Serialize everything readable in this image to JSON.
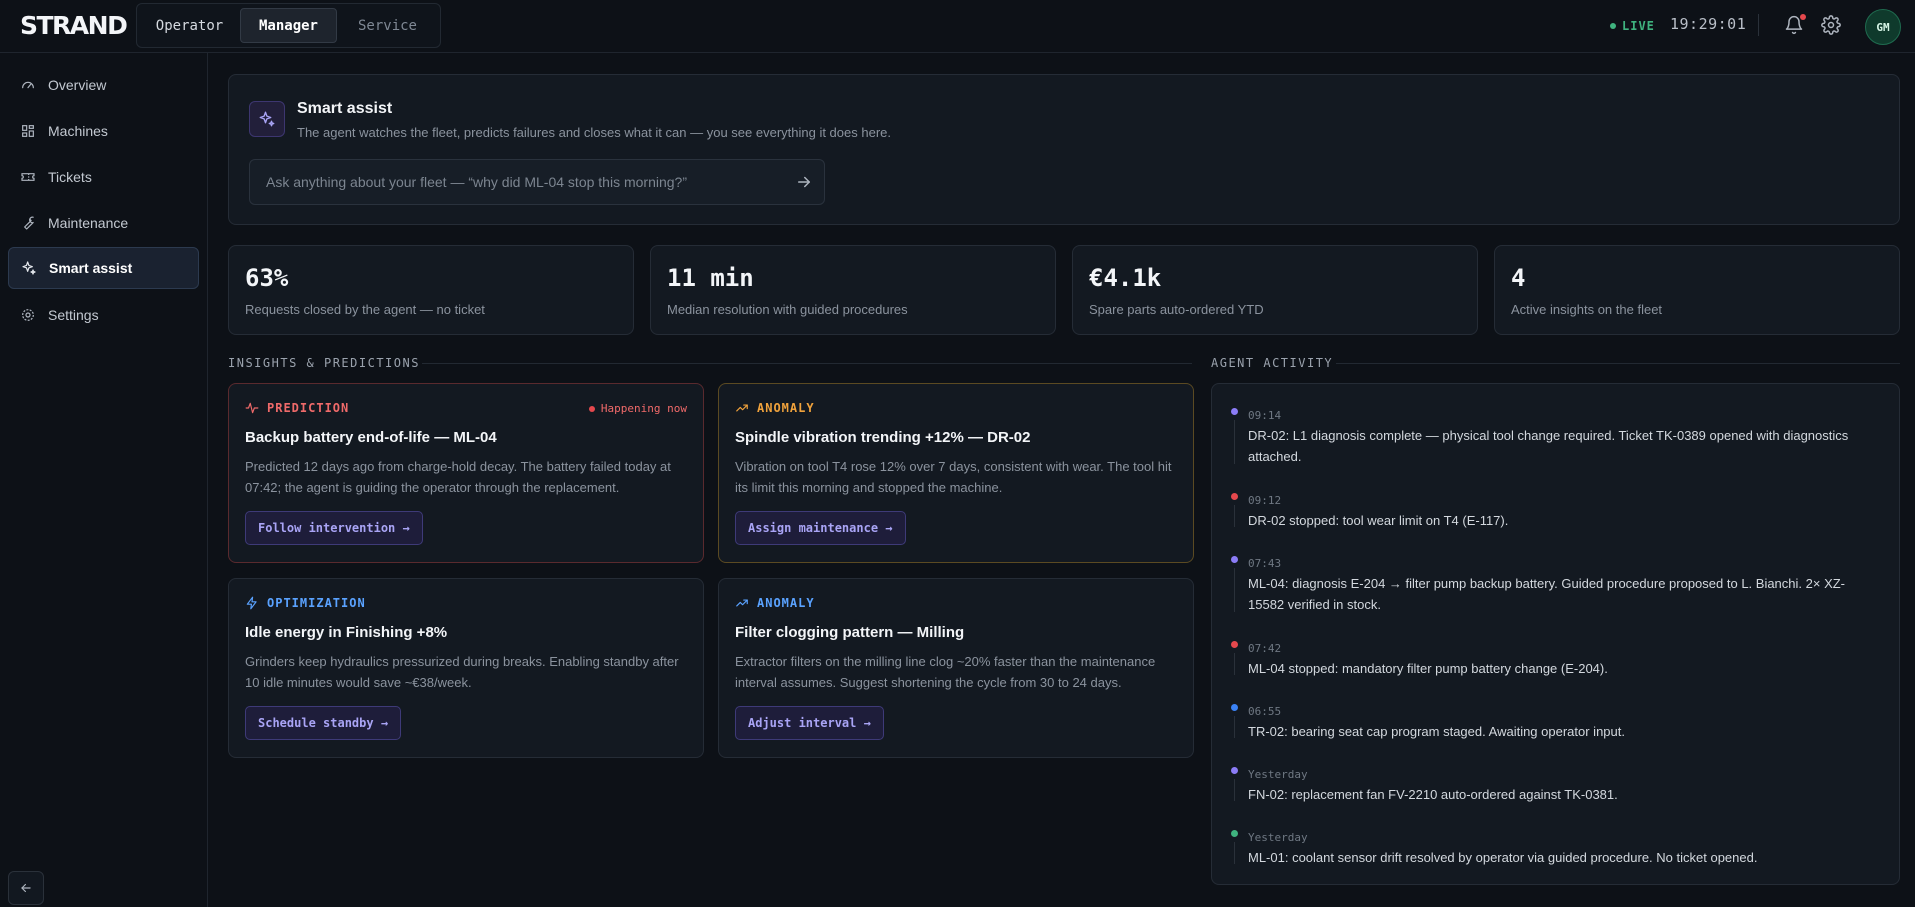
{
  "app": {
    "logo": "STRAND"
  },
  "roles": [
    {
      "label": "Operator"
    },
    {
      "label": "Manager"
    },
    {
      "label": "Service"
    }
  ],
  "status": {
    "live": "LIVE",
    "time": "19:29:01",
    "avatar": "GM"
  },
  "sidebar": {
    "items": [
      {
        "label": "Overview",
        "icon": "gauge-icon"
      },
      {
        "label": "Machines",
        "icon": "grid-icon"
      },
      {
        "label": "Tickets",
        "icon": "ticket-icon"
      },
      {
        "label": "Maintenance",
        "icon": "wrench-icon"
      },
      {
        "label": "Smart assist",
        "icon": "sparkles-icon"
      },
      {
        "label": "Settings",
        "icon": "gear-icon"
      }
    ],
    "active": "Smart assist"
  },
  "assist": {
    "title": "Smart assist",
    "subtitle": "The agent watches the fleet, predicts failures and closes what it can — you see everything it does here.",
    "placeholder": "Ask anything about your fleet — “why did ML-04 stop this morning?”"
  },
  "stats": [
    {
      "value": "63%",
      "label": "Requests closed by the agent — no ticket"
    },
    {
      "value": "11 min",
      "label": "Median resolution with guided procedures"
    },
    {
      "value": "€4.1k",
      "label": "Spare parts auto-ordered YTD"
    },
    {
      "value": "4",
      "label": "Active insights on the fleet"
    }
  ],
  "insights": {
    "section_label": "INSIGHTS & PREDICTIONS",
    "cards": [
      {
        "type": "PREDICTION",
        "flag": "Happening now",
        "title": "Backup battery end-of-life — ML-04",
        "body": "Predicted 12 days ago from charge-hold decay. The battery failed today at 07:42; the agent is guiding the operator through the replacement.",
        "action": "Follow intervention →"
      },
      {
        "type": "ANOMALY",
        "title": "Spindle vibration trending +12% — DR-02",
        "body": "Vibration on tool T4 rose 12% over 7 days, consistent with wear. The tool hit its limit this morning and stopped the machine.",
        "action": "Assign maintenance →"
      },
      {
        "type": "OPTIMIZATION",
        "title": "Idle energy in Finishing +8%",
        "body": "Grinders keep hydraulics pressurized during breaks. Enabling standby after 10 idle minutes would save ~€38/week.",
        "action": "Schedule standby →"
      },
      {
        "type": "ANOMALY",
        "title": "Filter clogging pattern — Milling",
        "body": "Extractor filters on the milling line clog ~20% faster than the maintenance interval assumes. Suggest shortening the cycle from 30 to 24 days.",
        "action": "Adjust interval →"
      }
    ]
  },
  "activity": {
    "section_label": "AGENT ACTIVITY",
    "items": [
      {
        "time": "09:14",
        "text": "DR-02: L1 diagnosis complete — physical tool change required. Ticket TK-0389 opened with diagnostics attached.",
        "color": "#8b7cf6"
      },
      {
        "time": "09:12",
        "text": "DR-02 stopped: tool wear limit on T4 (E-117).",
        "color": "#e5484d"
      },
      {
        "time": "07:43",
        "text": "ML-04: diagnosis E-204 → filter pump backup battery. Guided procedure proposed to L. Bianchi. 2× XZ-15582 verified in stock.",
        "color": "#8b7cf6"
      },
      {
        "time": "07:42",
        "text": "ML-04 stopped: mandatory filter pump battery change (E-204).",
        "color": "#e5484d"
      },
      {
        "time": "06:55",
        "text": "TR-02: bearing seat cap program staged. Awaiting operator input.",
        "color": "#3b82f6"
      },
      {
        "time": "Yesterday",
        "text": "FN-02: replacement fan FV-2210 auto-ordered against TK-0381.",
        "color": "#8b7cf6"
      },
      {
        "time": "Yesterday",
        "text": "ML-01: coolant sensor drift resolved by operator via guided procedure. No ticket opened.",
        "color": "#3fb37f"
      }
    ]
  },
  "colors": {
    "prediction": "#f06a6a",
    "anomaly_warn": "#f0a23c",
    "anomaly_info": "#5aa2ff",
    "optimization": "#5aa2ff",
    "accent": "#a9a4f5",
    "live": "#3fb37f"
  }
}
